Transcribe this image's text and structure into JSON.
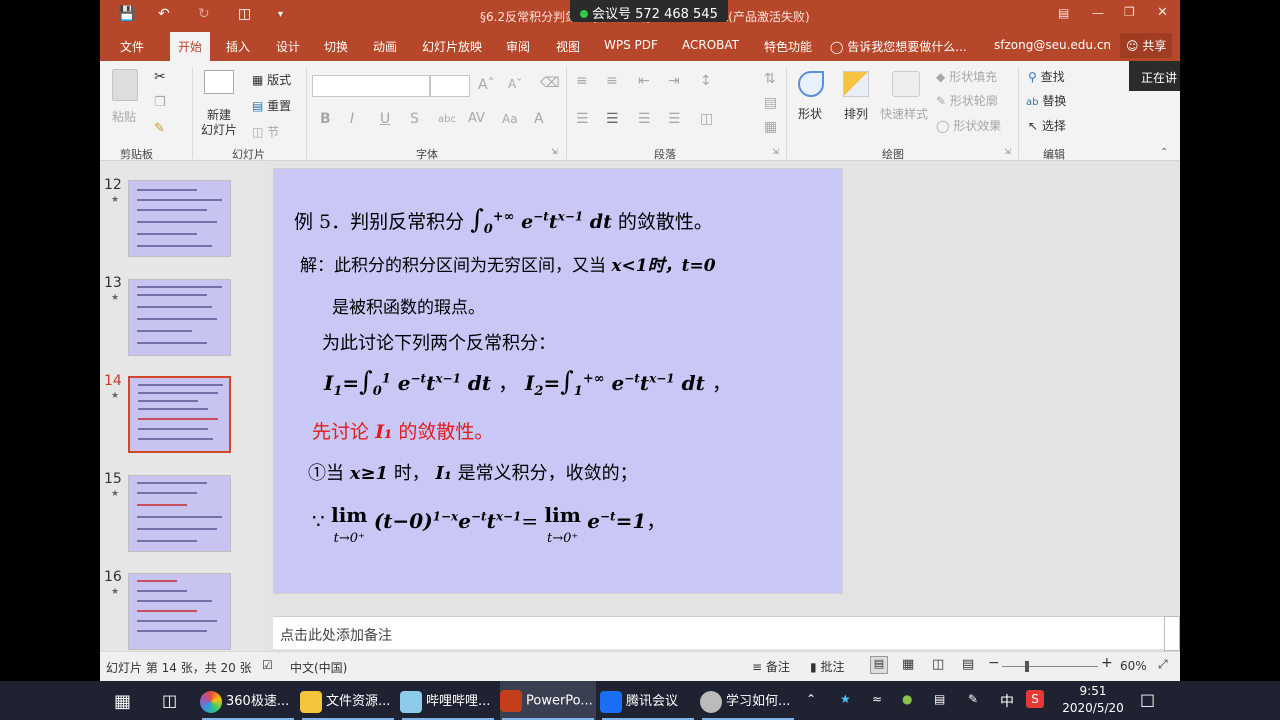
{
  "window": {
    "title": "§6.2反常积分判敛法 [兼容模式] - PowerPoint(产品激活失败)",
    "meeting_id": "会议号 572 468 545"
  },
  "ribbon_tabs": [
    "文件",
    "开始",
    "插入",
    "设计",
    "切换",
    "动画",
    "幻灯片放映",
    "审阅",
    "视图",
    "WPS PDF",
    "ACROBAT",
    "特色功能"
  ],
  "tell_me": "告诉我您想要做什么...",
  "user": "sfzong@seu.edu.cn",
  "share": "共享",
  "tooltip": "正在讲",
  "groups": {
    "clipboard": {
      "label": "剪贴板",
      "paste": "粘贴"
    },
    "slides": {
      "label": "幻灯片",
      "new_slide": "新建\n幻灯片",
      "layout": "版式",
      "reset": "重置",
      "section": "节"
    },
    "font": {
      "label": "字体"
    },
    "paragraph": {
      "label": "段落"
    },
    "drawing": {
      "label": "绘图",
      "shapes": "形状",
      "arrange": "排列",
      "quick_styles": "快速样式",
      "fill": "形状填充",
      "outline": "形状轮廓",
      "effects": "形状效果"
    },
    "editing": {
      "label": "编辑",
      "find": "查找",
      "replace": "替换",
      "select": "选择"
    }
  },
  "thumbnails": [
    {
      "num": "12",
      "selected": false
    },
    {
      "num": "13",
      "selected": false
    },
    {
      "num": "14",
      "selected": true
    },
    {
      "num": "15",
      "selected": false
    },
    {
      "num": "16",
      "selected": false
    }
  ],
  "slide": {
    "line1": "例 5．判别反常积分",
    "line1_tail": "的敛散性。",
    "line2": "解：此积分的积分区间为无穷区间，又当",
    "line2_math": "x<1时，t=0",
    "line3": "是被积函数的瑕点。",
    "line4": "为此讨论下列两个反常积分：",
    "line6": "先讨论",
    "line6_math": "I₁",
    "line6_tail": "的敛散性。",
    "line7": "①当",
    "line7_math": "x≥1",
    "line7_mid": "时，",
    "line7_tail": "是常义积分，收敛的；",
    "lim_text": "lim",
    "lim_sub": "t→0⁺"
  },
  "notes_placeholder": "点击此处添加备注",
  "status": {
    "slide_info": "幻灯片 第 14 张，共 20 张",
    "language": "中文(中国)",
    "notes": "备注",
    "comments": "批注",
    "zoom": "60%"
  },
  "taskbar": {
    "apps": [
      "360极速...",
      "文件资源...",
      "哔哩哔哩...",
      "PowerPo...",
      "腾讯会议",
      "学习如何..."
    ],
    "ime": "中",
    "time": "9:51",
    "date": "2020/5/20"
  },
  "colors": {
    "accent": "#b7472a",
    "slide_bg": "#c9c7f5",
    "red_text": "#e21b1b"
  }
}
